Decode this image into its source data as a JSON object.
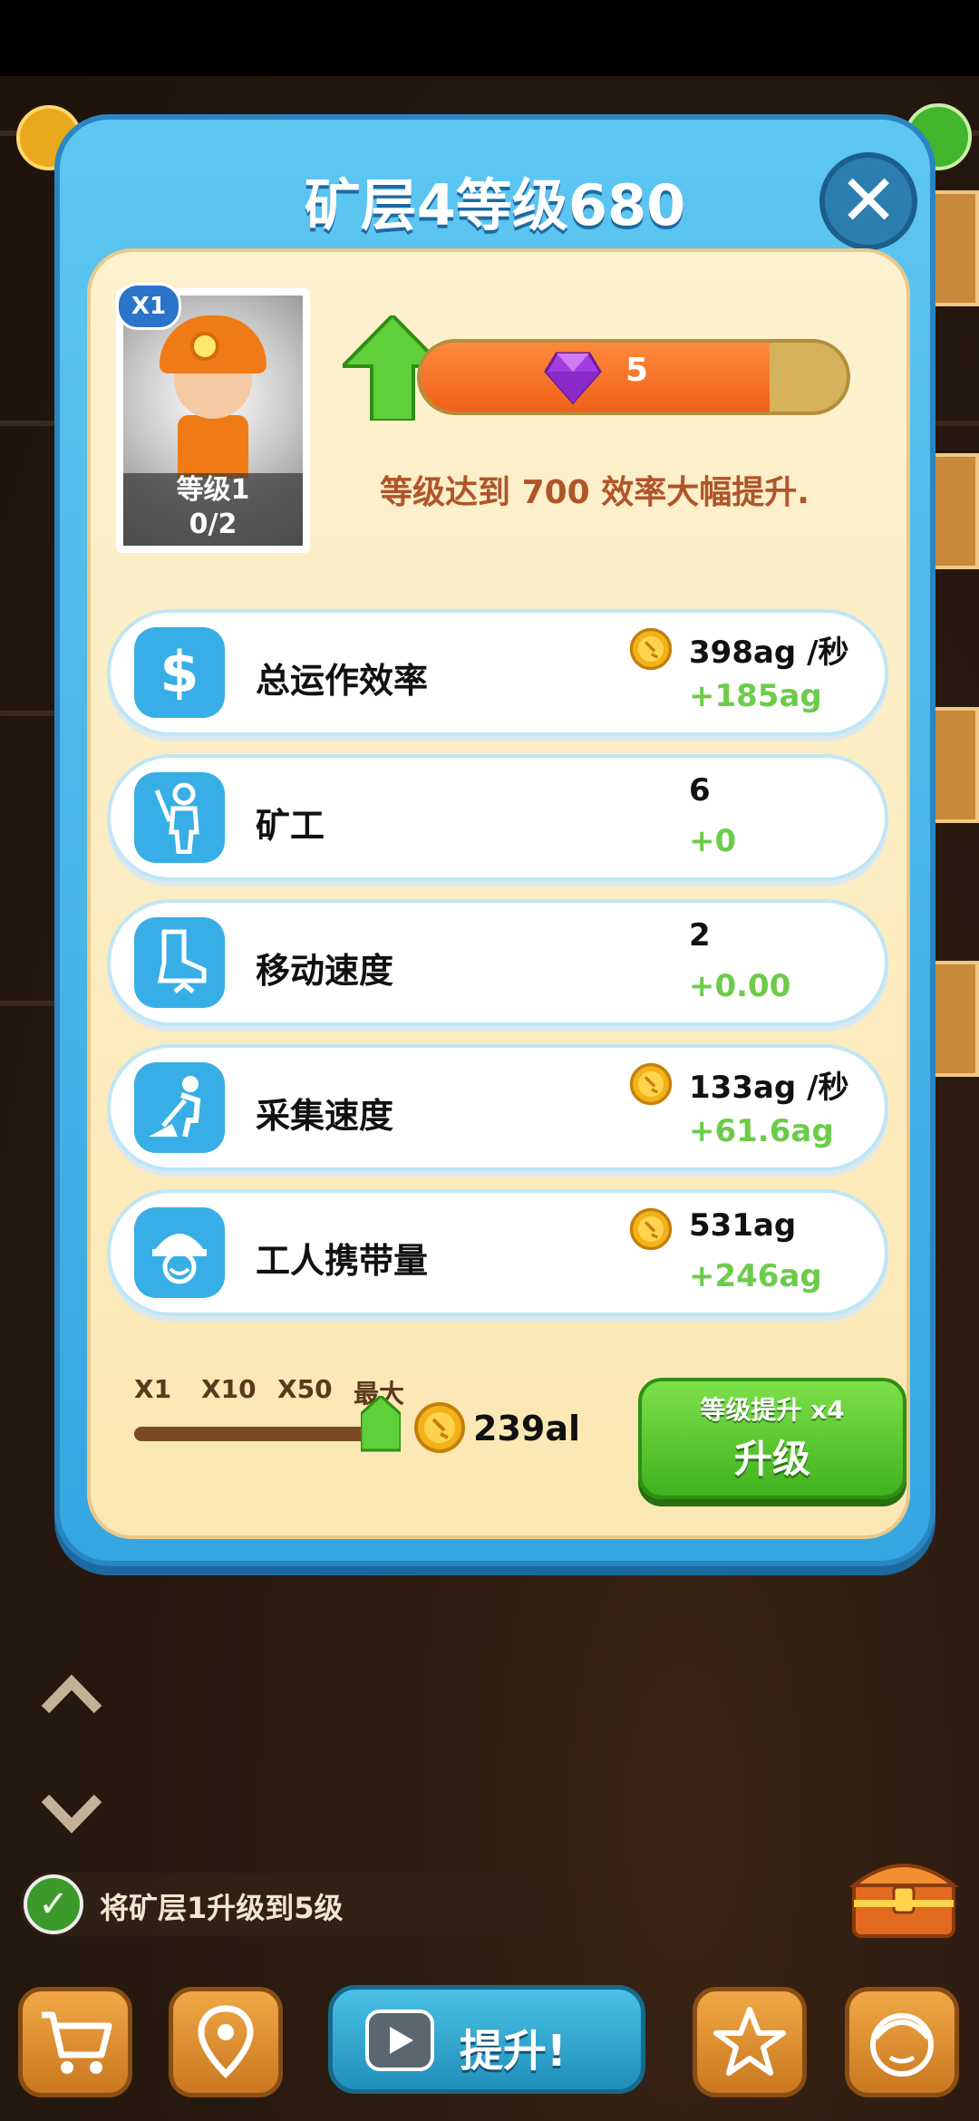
{
  "modal": {
    "title": "矿层4等级680",
    "close_icon": "close-icon"
  },
  "worker": {
    "multiplier_badge": "X1",
    "level": "等级1",
    "count": "0/2"
  },
  "progress": {
    "gem_value": "5",
    "fill_fraction": 0.82,
    "milestone_text": "等级达到 700 效率大幅提升."
  },
  "stats": [
    {
      "icon": "dollar-icon",
      "label": "总运作效率",
      "has_coin": true,
      "value": "398ag /秒",
      "delta": "+185ag"
    },
    {
      "icon": "miner-icon",
      "label": "矿工",
      "has_coin": false,
      "value": "6",
      "delta": "+0"
    },
    {
      "icon": "boot-icon",
      "label": "移动速度",
      "has_coin": false,
      "value": "2",
      "delta": "+0.00"
    },
    {
      "icon": "digging-icon",
      "label": "采集速度",
      "has_coin": true,
      "value": "133ag /秒",
      "delta": "+61.6ag"
    },
    {
      "icon": "helmet-icon",
      "label": "工人携带量",
      "has_coin": true,
      "value": "531ag",
      "delta": "+246ag"
    }
  ],
  "multipliers": [
    "X1",
    "X10",
    "X50",
    "最大"
  ],
  "slider_level": "最大",
  "cost": "239al",
  "upgrade_button": {
    "subtitle": "等级提升 x4",
    "label": "升级"
  },
  "task": {
    "text": "将矿层1升级到5级"
  },
  "hud": {
    "boost_label": "提升!"
  },
  "colors": {
    "modal_blue": "#47b8ec",
    "panel_cream": "#fdf1cf",
    "progress_orange": "#f0601a",
    "delta_green": "#6ccc4a",
    "upgrade_green": "#3fb21e"
  }
}
